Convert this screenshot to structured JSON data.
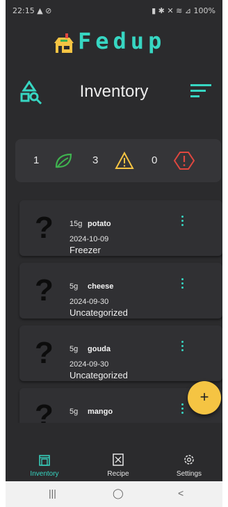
{
  "status_bar": {
    "time": "22:15",
    "left_icons": "▲ ⊘",
    "right_icons": "▮ ✱ ✕ ≋ ⊿",
    "battery": "100%"
  },
  "app": {
    "name": "Fedup",
    "accent_color": "#37d6c2"
  },
  "header": {
    "title": "Inventory",
    "left_icon": "shapes-search-icon",
    "right_icon": "sort-icon"
  },
  "summary": {
    "fresh_count": "1",
    "warning_count": "3",
    "expired_count": "0"
  },
  "items": [
    {
      "qty": "15g",
      "name": "potato",
      "date": "2024-10-09",
      "category": "Freezer"
    },
    {
      "qty": "5g",
      "name": "cheese",
      "date": "2024-09-30",
      "category": "Uncategorized"
    },
    {
      "qty": "5g",
      "name": "gouda",
      "date": "2024-09-30",
      "category": "Uncategorized"
    },
    {
      "qty": "5g",
      "name": "mango",
      "date": "",
      "category": ""
    }
  ],
  "fab": {
    "label": "+"
  },
  "tabs": [
    {
      "label": "Inventory",
      "icon": "inventory-icon",
      "active": true
    },
    {
      "label": "Recipe",
      "icon": "recipe-icon",
      "active": false
    },
    {
      "label": "Settings",
      "icon": "gear-icon",
      "active": false
    }
  ],
  "system_nav": {
    "recents": "|||",
    "home": "◯",
    "back": "<"
  }
}
